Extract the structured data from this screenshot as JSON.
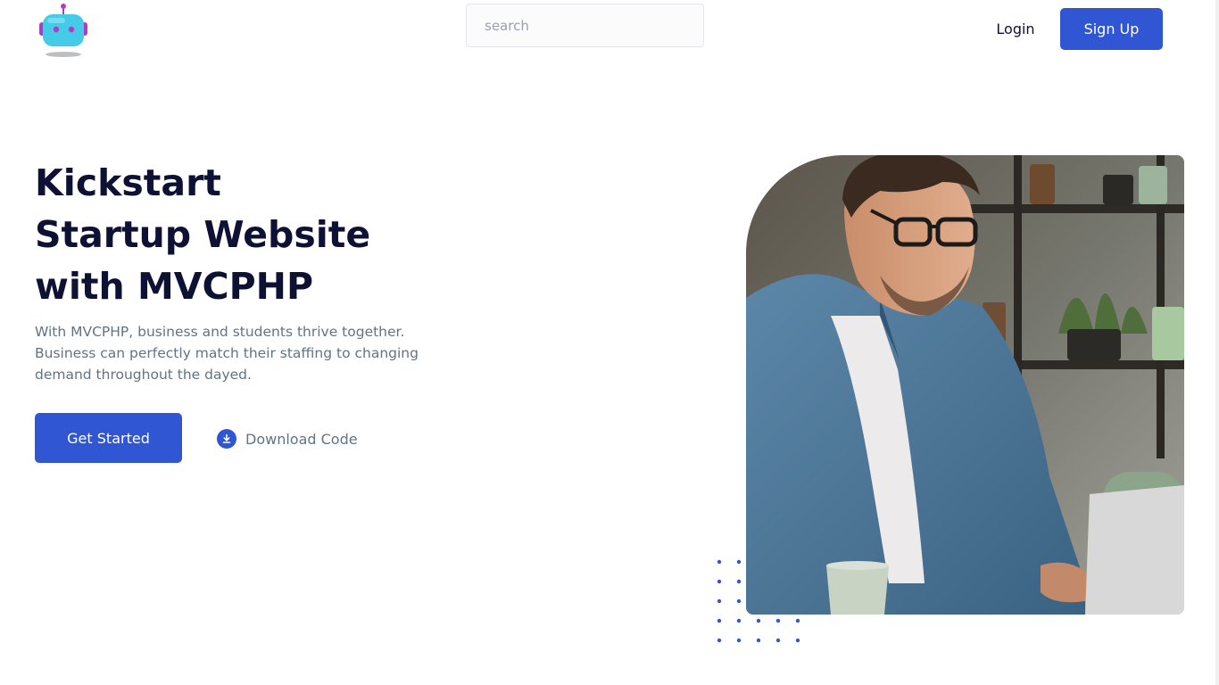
{
  "navbar": {
    "logo_icon": "robot-icon",
    "search_placeholder": "search",
    "login_label": "Login",
    "signup_label": "Sign Up"
  },
  "hero": {
    "title_lines": [
      "Kickstart",
      "Startup Website",
      "with MVCPHP"
    ],
    "description": "With MVCPHP, business and students thrive together. Business can perfectly match their staffing to changing demand throughout the dayed.",
    "get_started_label": "Get Started",
    "download_label": "Download Code",
    "download_icon": "download-icon",
    "image_icon": "man-with-laptop-photo"
  },
  "colors": {
    "primary": "#3056d3",
    "heading": "#0e1133",
    "body_text": "#637381",
    "robot_body": "#45cbe8",
    "robot_accent": "#b23cbf"
  }
}
